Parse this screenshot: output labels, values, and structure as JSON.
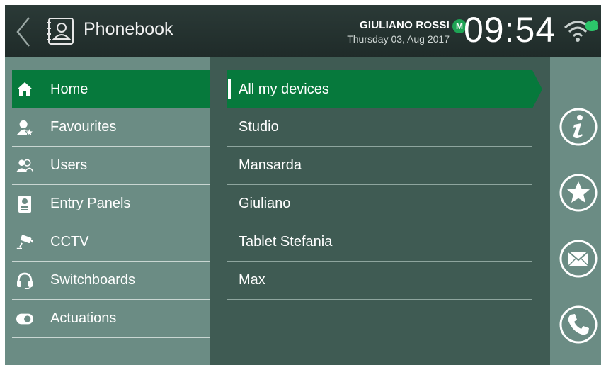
{
  "header": {
    "title": "Phonebook",
    "user_name": "GIULIANO ROSSI",
    "user_badge": "M",
    "date": "Thursday 03, Aug 2017",
    "time": "09:54"
  },
  "sidebar": {
    "items": [
      {
        "label": "Home",
        "icon": "home-icon",
        "active": true
      },
      {
        "label": "Favourites",
        "icon": "favourite-user-icon"
      },
      {
        "label": "Users",
        "icon": "users-icon"
      },
      {
        "label": "Entry Panels",
        "icon": "entry-panel-icon"
      },
      {
        "label": "CCTV",
        "icon": "cctv-icon"
      },
      {
        "label": "Switchboards",
        "icon": "headset-icon"
      },
      {
        "label": "Actuations",
        "icon": "toggle-icon"
      }
    ]
  },
  "devices": {
    "items": [
      {
        "label": "All my devices",
        "active": true
      },
      {
        "label": "Studio"
      },
      {
        "label": "Mansarda"
      },
      {
        "label": "Giuliano"
      },
      {
        "label": "Tablet Stefania"
      },
      {
        "label": "Max"
      }
    ]
  },
  "actions": {
    "items": [
      "info-icon",
      "star-icon",
      "mail-icon",
      "phone-icon"
    ]
  },
  "colors": {
    "accent": "#06793c",
    "header": "#24312f",
    "side_panel": "#6b8c84",
    "list_panel": "#3f5b53",
    "badge": "#1ea354",
    "cloud": "#2cc66a"
  }
}
